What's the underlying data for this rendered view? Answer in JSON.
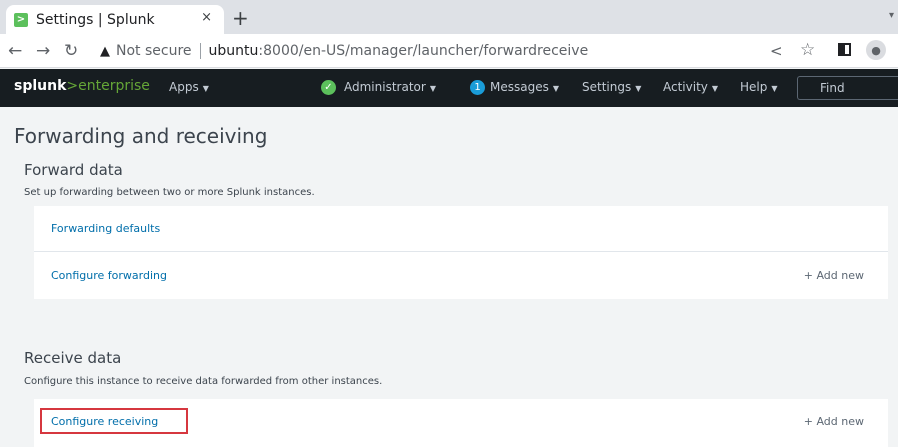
{
  "browser": {
    "tab_title": "Settings | Splunk",
    "tab_favicon": ">",
    "tab_close": "×",
    "new_tab": "+",
    "not_secure": "Not secure",
    "url_host": "ubuntu",
    "url_path": ":8000/en-US/manager/launcher/forwardreceive"
  },
  "splunkbar": {
    "logo_main": "splunk",
    "logo_gt": ">",
    "logo_product": "enterprise",
    "apps": "Apps",
    "administrator": "Administrator",
    "messages_count": "1",
    "messages": "Messages",
    "settings": "Settings",
    "activity": "Activity",
    "help": "Help",
    "find": "Find"
  },
  "page": {
    "title": "Forwarding and receiving",
    "forward": {
      "title": "Forward data",
      "description": "Set up forwarding between two or more Splunk instances.",
      "rows": [
        {
          "label": "Forwarding defaults",
          "action": ""
        },
        {
          "label": "Configure forwarding",
          "action": "+ Add new"
        }
      ]
    },
    "receive": {
      "title": "Receive data",
      "description": "Configure this instance to receive data forwarded from other instances.",
      "rows": [
        {
          "label": "Configure receiving",
          "action": "+ Add new"
        }
      ]
    }
  },
  "colors": {
    "splunk_bar": "#171d21",
    "accent_green": "#65a637",
    "link_blue": "#006eaa",
    "highlight_red": "#d6373f"
  }
}
